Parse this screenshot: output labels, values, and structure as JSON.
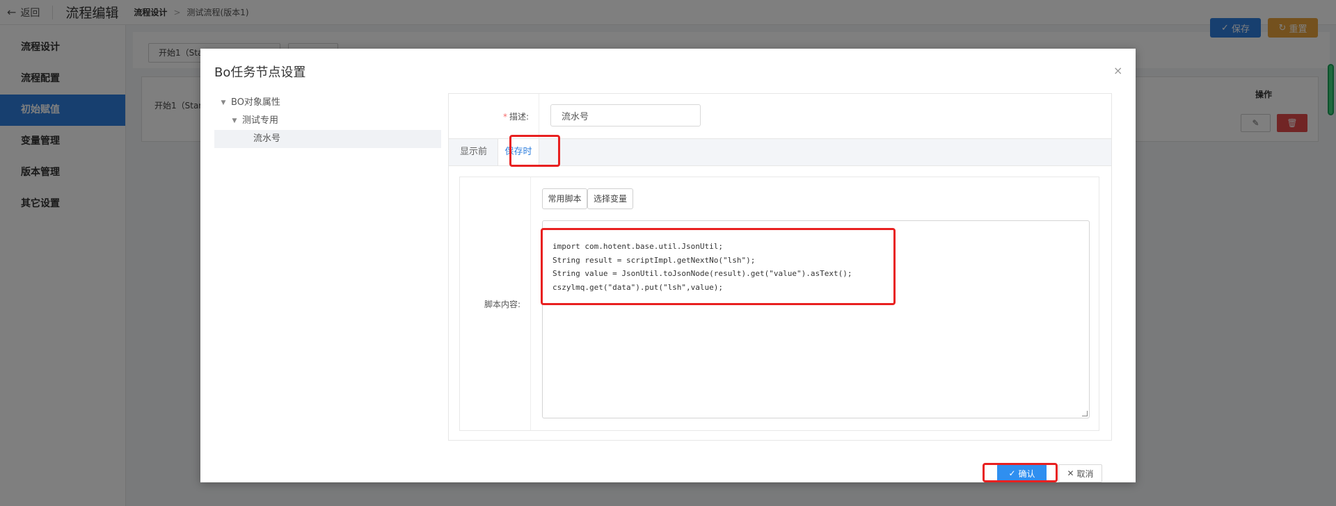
{
  "topbar": {
    "back_label": "返回",
    "page_title": "流程编辑",
    "breadcrumb": [
      "流程设计",
      "测试流程(版本1)"
    ],
    "breadcrumb_sep": ">"
  },
  "sidebar": {
    "items": [
      {
        "label": "流程设计",
        "active": false
      },
      {
        "label": "流程配置",
        "active": false
      },
      {
        "label": "初始赋值",
        "active": true
      },
      {
        "label": "变量管理",
        "active": false
      },
      {
        "label": "版本管理",
        "active": false
      },
      {
        "label": "其它设置",
        "active": false
      }
    ]
  },
  "background": {
    "node_button": "开始1（Sta",
    "save_label": "保存",
    "reset_label": "重置",
    "table_cell": "开始1（Star",
    "operation_header": "操作"
  },
  "dialog": {
    "title": "Bo任务节点设置",
    "close_glyph": "×",
    "tree": [
      {
        "label": "BO对象属性",
        "level": 0,
        "expanded": true
      },
      {
        "label": "测试专用",
        "level": 1,
        "expanded": true
      },
      {
        "label": "流水号",
        "level": 2,
        "selected": true
      }
    ],
    "description_label": "描述:",
    "description_value": "流水号",
    "tabs": [
      {
        "label": "显示前",
        "active": false
      },
      {
        "label": "保存时",
        "active": true
      }
    ],
    "script_label": "脚本内容:",
    "script_buttons": [
      "常用脚本",
      "选择变量"
    ],
    "code_lines": [
      "import com.hotent.base.util.JsonUtil;",
      "String result = scriptImpl.getNextNo(\"lsh\");",
      "String value = JsonUtil.toJsonNode(result).get(\"value\").asText();",
      "cszylmq.get(\"data\").put(\"lsh\",value);"
    ],
    "confirm_label": "确认",
    "cancel_label": "取消"
  },
  "colors": {
    "primary": "#2f7fde",
    "warning": "#e8a33d",
    "danger": "#e24b4b",
    "highlight": "#e82020"
  }
}
